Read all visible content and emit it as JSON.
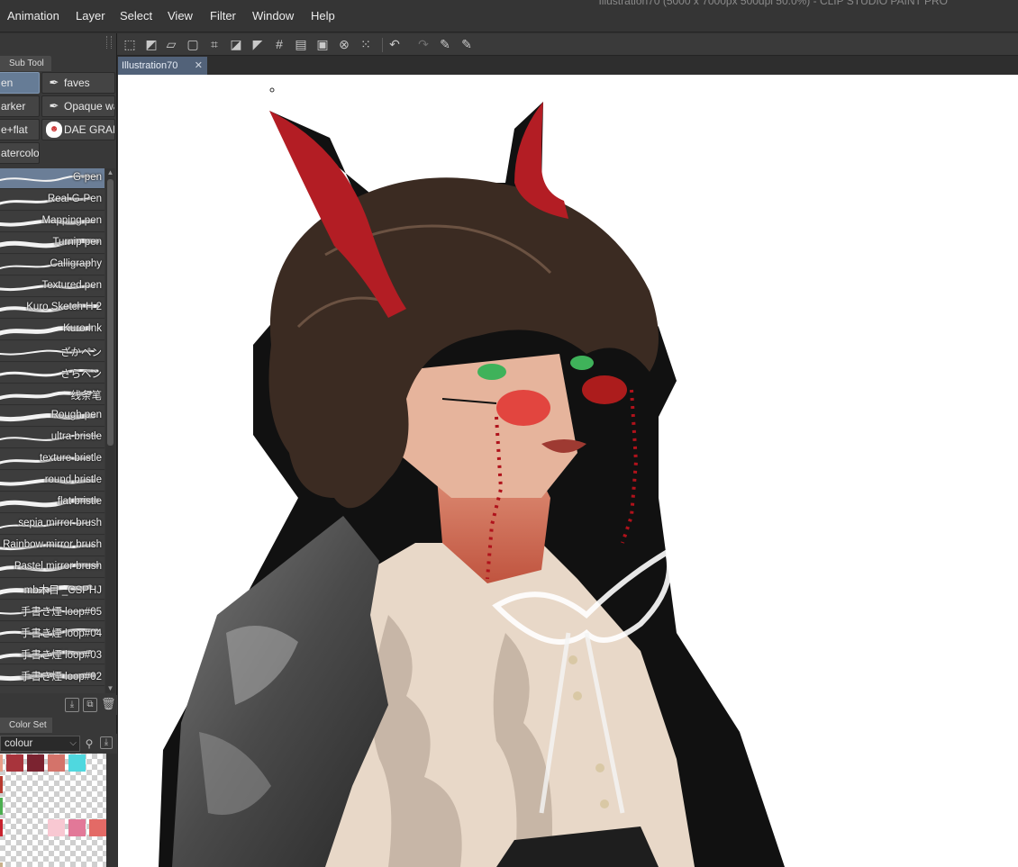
{
  "window": {
    "title": "Illustration70 (5000 x 7000px 500dpi 50.0%)  - CLIP STUDIO PAINT PRO"
  },
  "menu": [
    "Animation",
    "Layer",
    "Select",
    "View",
    "Filter",
    "Window",
    "Help"
  ],
  "command_bar": {
    "icons": [
      "clear-selection-icon",
      "invert-selection-icon",
      "transform-icon",
      "scale-icon",
      "crop-icon",
      "fill-icon",
      "tone-icon",
      "grid-icon",
      "layer-icon",
      "record-icon",
      "rotate-reset-icon",
      "settings-icon",
      "undo-icon",
      "redo-icon",
      "pen-icon",
      "pen-alt-icon"
    ]
  },
  "subtool_panel": {
    "tab_label": "Sub Tool",
    "groups": [
      {
        "label": "en",
        "active": true
      },
      {
        "label": "faves",
        "active": false
      },
      {
        "label": "arker",
        "active": false
      },
      {
        "label": "Opaque wa",
        "active": false
      },
      {
        "label": "e+flat",
        "active": false
      },
      {
        "label": "DAE GRAF",
        "active": false
      },
      {
        "label": "atercolor",
        "active": false
      }
    ],
    "brushes": [
      {
        "name": "G-pen",
        "active": true
      },
      {
        "name": "Real G-Pen",
        "active": false
      },
      {
        "name": "Mapping pen",
        "active": false
      },
      {
        "name": "Turnip pen",
        "active": false
      },
      {
        "name": "Calligraphy",
        "active": false
      },
      {
        "name": "Textured pen",
        "active": false
      },
      {
        "name": "Kuro Sketch H 2",
        "active": false
      },
      {
        "name": "Kuro Ink",
        "active": false
      },
      {
        "name": "ざかペン",
        "active": false
      },
      {
        "name": "さらペン",
        "active": false
      },
      {
        "name": "线条笔",
        "active": false
      },
      {
        "name": "Rough pen",
        "active": false
      },
      {
        "name": "ultra bristle",
        "active": false
      },
      {
        "name": "texture bristle",
        "active": false
      },
      {
        "name": "round bristle",
        "active": false
      },
      {
        "name": "flat bristle",
        "active": false
      },
      {
        "name": "sepia mirror brush",
        "active": false
      },
      {
        "name": "Rainbow mirror brush",
        "active": false
      },
      {
        "name": "Pastel mirror brush",
        "active": false
      },
      {
        "name": "mb木目 _CSPHJ",
        "active": false
      },
      {
        "name": "手書き煙 loop#05",
        "active": false
      },
      {
        "name": "手書き煙 loop#04",
        "active": false
      },
      {
        "name": "手書き煙 loop#03",
        "active": false
      },
      {
        "name": "手書き煙 loop#02",
        "active": false
      }
    ]
  },
  "color_set": {
    "tab_label": "Color Set",
    "selected_set": "colour",
    "swatches": [
      {
        "row": 0,
        "col": 0,
        "color": "#e8a08a"
      },
      {
        "row": 0,
        "col": 1,
        "color": "#a8343c"
      },
      {
        "row": 0,
        "col": 2,
        "color": "#7b2330"
      },
      {
        "row": 0,
        "col": 3,
        "color": "#d4736a"
      },
      {
        "row": 0,
        "col": 4,
        "color": "#4fd8df"
      },
      {
        "row": 1,
        "col": 0,
        "color": "#b83a30"
      },
      {
        "row": 2,
        "col": 0,
        "color": "#4caf50"
      },
      {
        "row": 3,
        "col": 0,
        "color": "#c8232f"
      },
      {
        "row": 3,
        "col": 3,
        "color": "#f8c8d2"
      },
      {
        "row": 3,
        "col": 4,
        "color": "#e27898"
      },
      {
        "row": 3,
        "col": 5,
        "color": "#e36a66"
      },
      {
        "row": 5,
        "col": 0,
        "color": "#c9b08a"
      }
    ]
  },
  "document": {
    "tab_label": "Illustration70"
  },
  "colors": {
    "menubar": "#353535",
    "panel": "#383838",
    "active_tab": "#526279",
    "active_item": "#667c96",
    "canvas": "#ffffff"
  }
}
